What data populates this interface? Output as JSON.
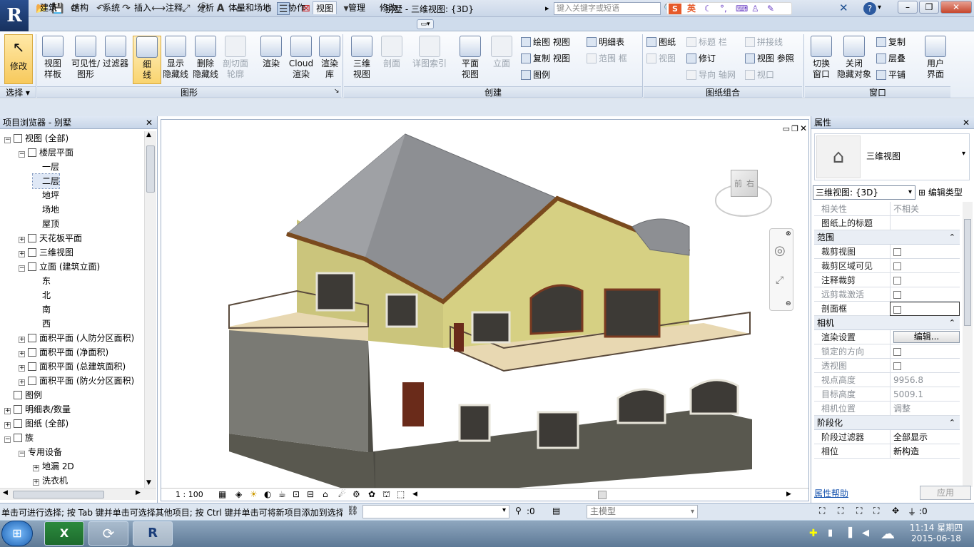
{
  "app": {
    "logo": "R",
    "title": "别墅 - 三维视图: {3D}",
    "search_placeholder": "键入关键字或短语",
    "ime": "英"
  },
  "tabs": [
    "建筑",
    "结构",
    "系统",
    "插入",
    "注释",
    "分析",
    "体量和场地",
    "协作",
    "视图",
    "管理",
    "修改"
  ],
  "active_tab": "视图",
  "ribbon": {
    "modify": "修改",
    "select_group": "选择",
    "graphics": {
      "label": "图形",
      "buttons": [
        "视图\n样板",
        "可见性/\n图形",
        "过滤器",
        "细\n线",
        "显示\n隐藏线",
        "删除\n隐藏线",
        "剖切面\n轮廓",
        "渲染",
        "Cloud\n渲染",
        "渲染\n库"
      ]
    },
    "create": {
      "label": "创建",
      "buttons": [
        "三维\n视图",
        "剖面",
        "详图索引",
        "平面\n视图",
        "立面"
      ],
      "small": [
        "绘图 视图",
        "复制 视图",
        "图例",
        "明细表",
        "范围 框"
      ]
    },
    "sheet": {
      "label": "图纸组合",
      "small": [
        "图纸",
        "标题 栏",
        "拼接线",
        "视图",
        "修订",
        "视图 参照",
        "导向 轴网",
        "视口"
      ]
    },
    "window": {
      "label": "窗口",
      "buttons": [
        "切换\n窗口",
        "关闭\n隐藏对象",
        "用户\n界面"
      ],
      "small": [
        "复制",
        "层叠",
        "平铺"
      ]
    }
  },
  "project_browser": {
    "title": "项目浏览器 - 别墅",
    "nodes": [
      {
        "label": "视图 (全部)",
        "level": 0,
        "toggle": "⊟"
      },
      {
        "label": "楼层平面",
        "level": 1,
        "toggle": "⊟"
      },
      {
        "label": "一层",
        "level": 2,
        "toggle": ""
      },
      {
        "label": "二层",
        "level": 2,
        "toggle": "",
        "selected": true
      },
      {
        "label": "地坪",
        "level": 2,
        "toggle": ""
      },
      {
        "label": "场地",
        "level": 2,
        "toggle": ""
      },
      {
        "label": "屋顶",
        "level": 2,
        "toggle": ""
      },
      {
        "label": "天花板平面",
        "level": 1,
        "toggle": "⊞"
      },
      {
        "label": "三维视图",
        "level": 1,
        "toggle": "⊞"
      },
      {
        "label": "立面 (建筑立面)",
        "level": 1,
        "toggle": "⊟"
      },
      {
        "label": "东",
        "level": 2,
        "toggle": ""
      },
      {
        "label": "北",
        "level": 2,
        "toggle": ""
      },
      {
        "label": "南",
        "level": 2,
        "toggle": ""
      },
      {
        "label": "西",
        "level": 2,
        "toggle": ""
      },
      {
        "label": "面积平面 (人防分区面积)",
        "level": 1,
        "toggle": "⊞"
      },
      {
        "label": "面积平面 (净面积)",
        "level": 1,
        "toggle": "⊞"
      },
      {
        "label": "面积平面 (总建筑面积)",
        "level": 1,
        "toggle": "⊞"
      },
      {
        "label": "面积平面 (防火分区面积)",
        "level": 1,
        "toggle": "⊞"
      },
      {
        "label": "图例",
        "level": 0,
        "toggle": ""
      },
      {
        "label": "明细表/数量",
        "level": 0,
        "toggle": "⊞"
      },
      {
        "label": "图纸 (全部)",
        "level": 0,
        "toggle": "⊞"
      },
      {
        "label": "族",
        "level": 0,
        "toggle": "⊟"
      },
      {
        "label": "专用设备",
        "level": 1,
        "toggle": "⊟"
      },
      {
        "label": "地漏 2D",
        "level": 2,
        "toggle": "⊞"
      },
      {
        "label": "洗衣机",
        "level": 2,
        "toggle": "⊞"
      }
    ]
  },
  "viewport": {
    "scale": "1 : 100",
    "viewcube": {
      "front": "前",
      "right": "右"
    }
  },
  "properties": {
    "title": "属性",
    "type_name": "三维视图",
    "selector": "三维视图: {3D}",
    "edit_type": "编辑类型",
    "help": "属性帮助",
    "apply": "应用",
    "rows": [
      {
        "kind": "row",
        "k": "相关性",
        "v": "不相关",
        "dis": true
      },
      {
        "kind": "row",
        "k": "图纸上的标题",
        "v": ""
      },
      {
        "kind": "sec",
        "k": "范围"
      },
      {
        "kind": "chk",
        "k": "裁剪视图"
      },
      {
        "kind": "chk",
        "k": "裁剪区域可见"
      },
      {
        "kind": "chk",
        "k": "注释裁剪"
      },
      {
        "kind": "chk",
        "k": "远剪裁激活",
        "dis": true
      },
      {
        "kind": "chk",
        "k": "剖面框",
        "sel": true
      },
      {
        "kind": "sec",
        "k": "相机"
      },
      {
        "kind": "btn",
        "k": "渲染设置",
        "v": "编辑..."
      },
      {
        "kind": "chk",
        "k": "锁定的方向",
        "dis": true
      },
      {
        "kind": "chk",
        "k": "透视图",
        "dis": true
      },
      {
        "kind": "row",
        "k": "视点高度",
        "v": "9956.8",
        "dis": true
      },
      {
        "kind": "row",
        "k": "目标高度",
        "v": "5009.1",
        "dis": true
      },
      {
        "kind": "row",
        "k": "相机位置",
        "v": "调整",
        "dis": true
      },
      {
        "kind": "sec",
        "k": "阶段化"
      },
      {
        "kind": "row",
        "k": "阶段过滤器",
        "v": "全部显示"
      },
      {
        "kind": "row",
        "k": "相位",
        "v": "新构造"
      }
    ]
  },
  "status": {
    "message": "单击可进行选择; 按 Tab 键并单击可选择其他项目; 按 Ctrl 键并单击可将新项目添加到选择",
    "workset": ":0",
    "model": "主模型",
    "filter_count": ":0"
  },
  "taskbar": {
    "time": "11:14 星期四",
    "date": "2015-06-18"
  },
  "colors": {
    "ribbon_accent": "#cfdcec",
    "roof": "#8d8f93",
    "wall": "#cfc97a",
    "stone": "#5b5a52"
  }
}
